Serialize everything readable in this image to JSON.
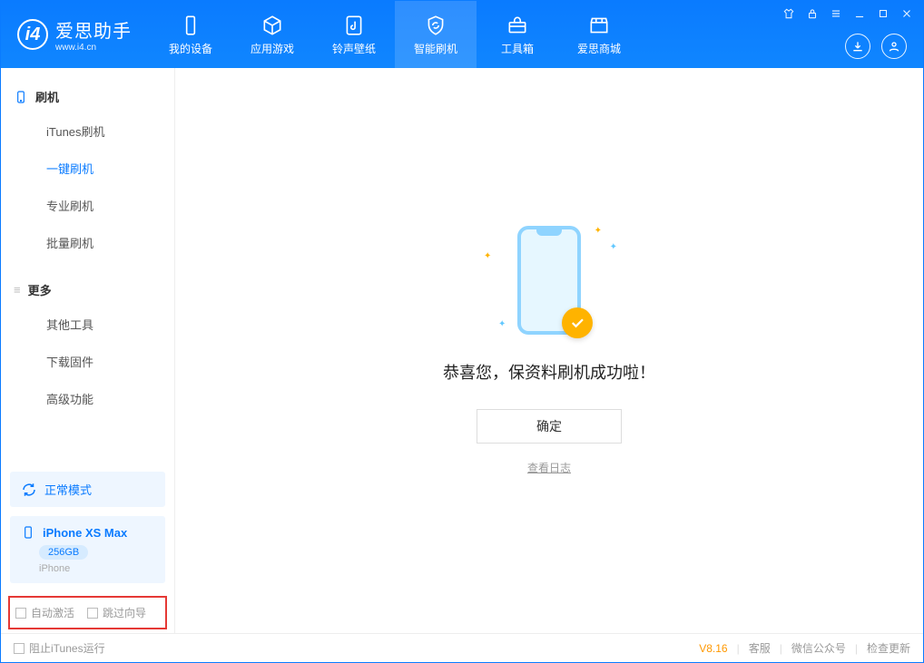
{
  "app": {
    "title": "爱思助手",
    "subtitle": "www.i4.cn"
  },
  "nav": {
    "tabs": [
      {
        "label": "我的设备"
      },
      {
        "label": "应用游戏"
      },
      {
        "label": "铃声壁纸"
      },
      {
        "label": "智能刷机"
      },
      {
        "label": "工具箱"
      },
      {
        "label": "爱思商城"
      }
    ]
  },
  "sidebar": {
    "section1": {
      "title": "刷机",
      "items": [
        "iTunes刷机",
        "一键刷机",
        "专业刷机",
        "批量刷机"
      ]
    },
    "section2": {
      "title": "更多",
      "items": [
        "其他工具",
        "下载固件",
        "高级功能"
      ]
    },
    "mode": "正常模式",
    "device": {
      "name": "iPhone XS Max",
      "storage": "256GB",
      "type": "iPhone"
    },
    "checks": {
      "auto_activate": "自动激活",
      "skip_wizard": "跳过向导"
    }
  },
  "main": {
    "message": "恭喜您，保资料刷机成功啦！",
    "ok": "确定",
    "log": "查看日志"
  },
  "status": {
    "block_itunes": "阻止iTunes运行",
    "version": "V8.16",
    "links": [
      "客服",
      "微信公众号",
      "检查更新"
    ]
  }
}
